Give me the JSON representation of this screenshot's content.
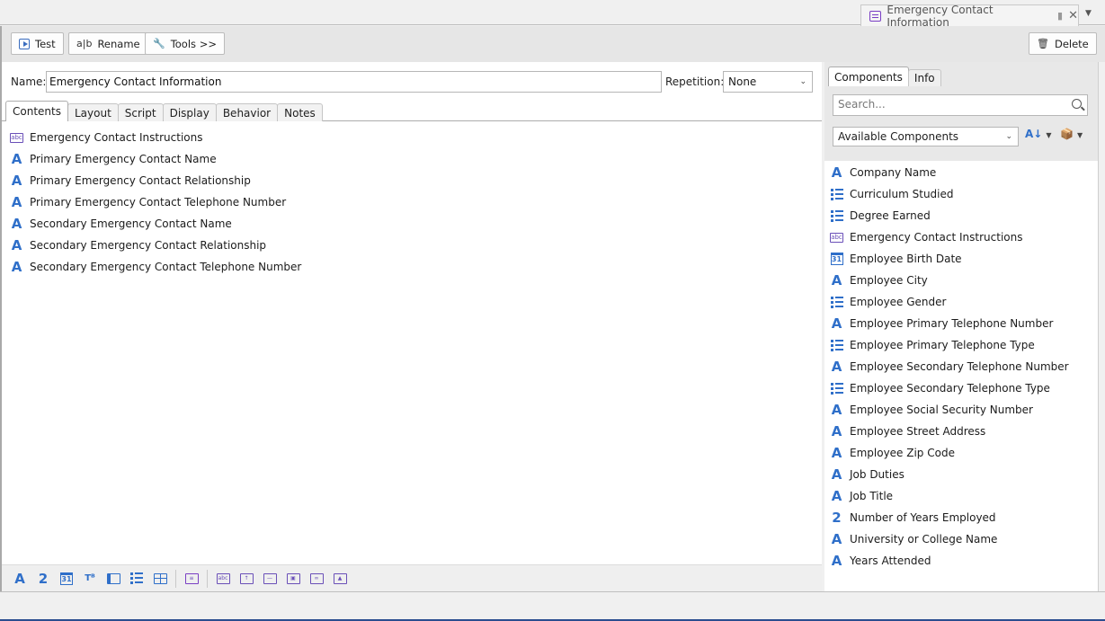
{
  "document_tab": {
    "title": "Emergency Contact Information"
  },
  "toolbar": {
    "test_label": "Test",
    "rename_icon": "a|b",
    "rename_label": "Rename",
    "tools_label": "Tools >>",
    "delete_label": "Delete"
  },
  "form": {
    "name_label": "Name:",
    "name_value": "Emergency Contact Information",
    "repetition_label": "Repetition:",
    "repetition_value": "None"
  },
  "subtabs": [
    "Contents",
    "Layout",
    "Script",
    "Display",
    "Behavior",
    "Notes"
  ],
  "contents": [
    {
      "icon": "text-block-icon",
      "label": "Emergency Contact Instructions"
    },
    {
      "icon": "text-field-icon",
      "label": "Primary Emergency Contact Name"
    },
    {
      "icon": "text-field-icon",
      "label": "Primary Emergency Contact Relationship"
    },
    {
      "icon": "text-field-icon",
      "label": "Primary Emergency Contact Telephone Number"
    },
    {
      "icon": "text-field-icon",
      "label": "Secondary Emergency Contact Name"
    },
    {
      "icon": "text-field-icon",
      "label": "Secondary Emergency Contact Relationship"
    },
    {
      "icon": "text-field-icon",
      "label": "Secondary Emergency Contact Telephone Number"
    }
  ],
  "right_panel": {
    "tabs": [
      "Components",
      "Info"
    ],
    "search_placeholder": "Search...",
    "filter_value": "Available Components",
    "components": [
      {
        "icon": "text-field-icon",
        "label": "Company Name"
      },
      {
        "icon": "list-icon",
        "label": "Curriculum Studied"
      },
      {
        "icon": "list-icon",
        "label": "Degree Earned"
      },
      {
        "icon": "text-block-icon",
        "label": "Emergency Contact Instructions"
      },
      {
        "icon": "calendar-icon",
        "label": "Employee Birth Date"
      },
      {
        "icon": "text-field-icon",
        "label": "Employee City"
      },
      {
        "icon": "list-icon",
        "label": "Employee Gender"
      },
      {
        "icon": "text-field-icon",
        "label": "Employee Primary Telephone Number"
      },
      {
        "icon": "list-icon",
        "label": "Employee Primary Telephone Type"
      },
      {
        "icon": "text-field-icon",
        "label": "Employee Secondary Telephone Number"
      },
      {
        "icon": "list-icon",
        "label": "Employee Secondary Telephone Type"
      },
      {
        "icon": "text-field-icon",
        "label": "Employee Social Security Number"
      },
      {
        "icon": "text-field-icon",
        "label": "Employee Street Address"
      },
      {
        "icon": "text-field-icon",
        "label": "Employee Zip Code"
      },
      {
        "icon": "text-field-icon",
        "label": "Job Duties"
      },
      {
        "icon": "text-field-icon",
        "label": "Job Title"
      },
      {
        "icon": "number-field-icon",
        "label": "Number of Years Employed"
      },
      {
        "icon": "text-field-icon",
        "label": "University or College Name"
      },
      {
        "icon": "text-field-icon",
        "label": "Years Attended"
      }
    ]
  },
  "bottom_toolbar": [
    "text-field-icon",
    "number-field-icon",
    "date-field-icon",
    "text-format-icon",
    "indent-list-icon",
    "numbered-list-icon",
    "grid-icon",
    "subform-icon",
    "text-block-icon",
    "upload-icon",
    "divider-icon",
    "image-button-icon",
    "link-icon",
    "image-icon"
  ],
  "colors": {
    "accent": "#2f6fc9",
    "purple": "#6a4fb8"
  }
}
